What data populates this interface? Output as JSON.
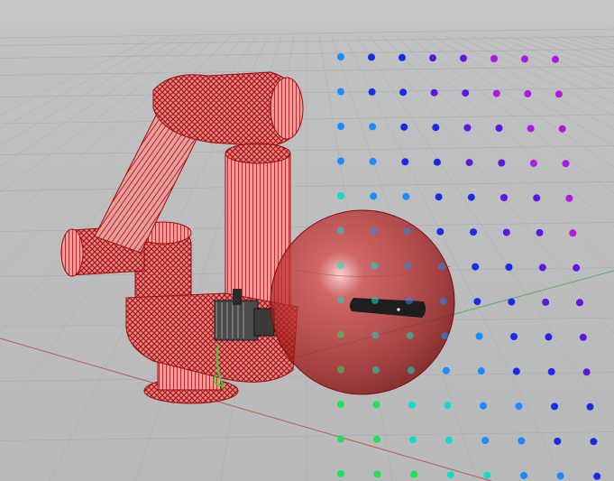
{
  "viewport": {
    "background_top": "#c9cacb",
    "background_bottom": "#b7b9bb",
    "grid_color": "#a9abad",
    "axis_x_color": "#b85c5c",
    "axis_y_color": "#6aa86a"
  },
  "robot": {
    "mesh_color": "#c01818",
    "fill_color": "#d84848",
    "tool_color": "#404040"
  },
  "workspace_sphere": {
    "color": "#b01c1c",
    "opacity": 0.6,
    "target_color": "#222222"
  },
  "point_cloud": {
    "colormap": [
      "#22e05a",
      "#11dcc8",
      "#1a8cff",
      "#1a2ae6",
      "#5a18e0",
      "#b01ae0"
    ],
    "rows": 14,
    "columns": 8
  }
}
